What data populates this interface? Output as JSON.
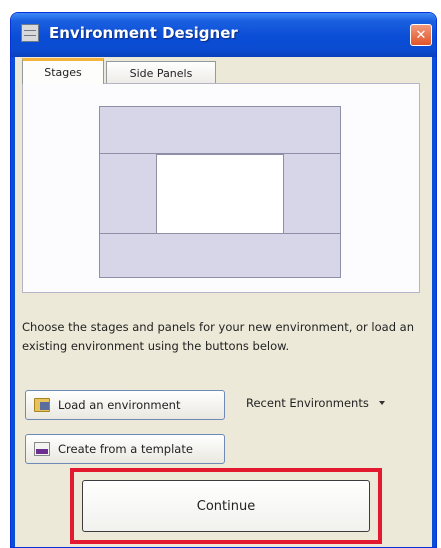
{
  "window": {
    "title": "Environment Designer",
    "close_glyph": "✕"
  },
  "tabs": [
    {
      "label": "Stages",
      "active": true
    },
    {
      "label": "Side Panels",
      "active": false
    }
  ],
  "description": "Choose the stages and panels for your new environment, or load an existing environment using the buttons below.",
  "buttons": {
    "load": {
      "label": "Load an environment",
      "icon": "folder-icon"
    },
    "template": {
      "label": "Create from a template",
      "icon": "template-icon"
    },
    "continue": {
      "label": "Continue"
    }
  },
  "recent": {
    "label": "Recent Environments"
  },
  "colors": {
    "highlight": "#e3192f",
    "titlebar": "#0a4dd6"
  }
}
